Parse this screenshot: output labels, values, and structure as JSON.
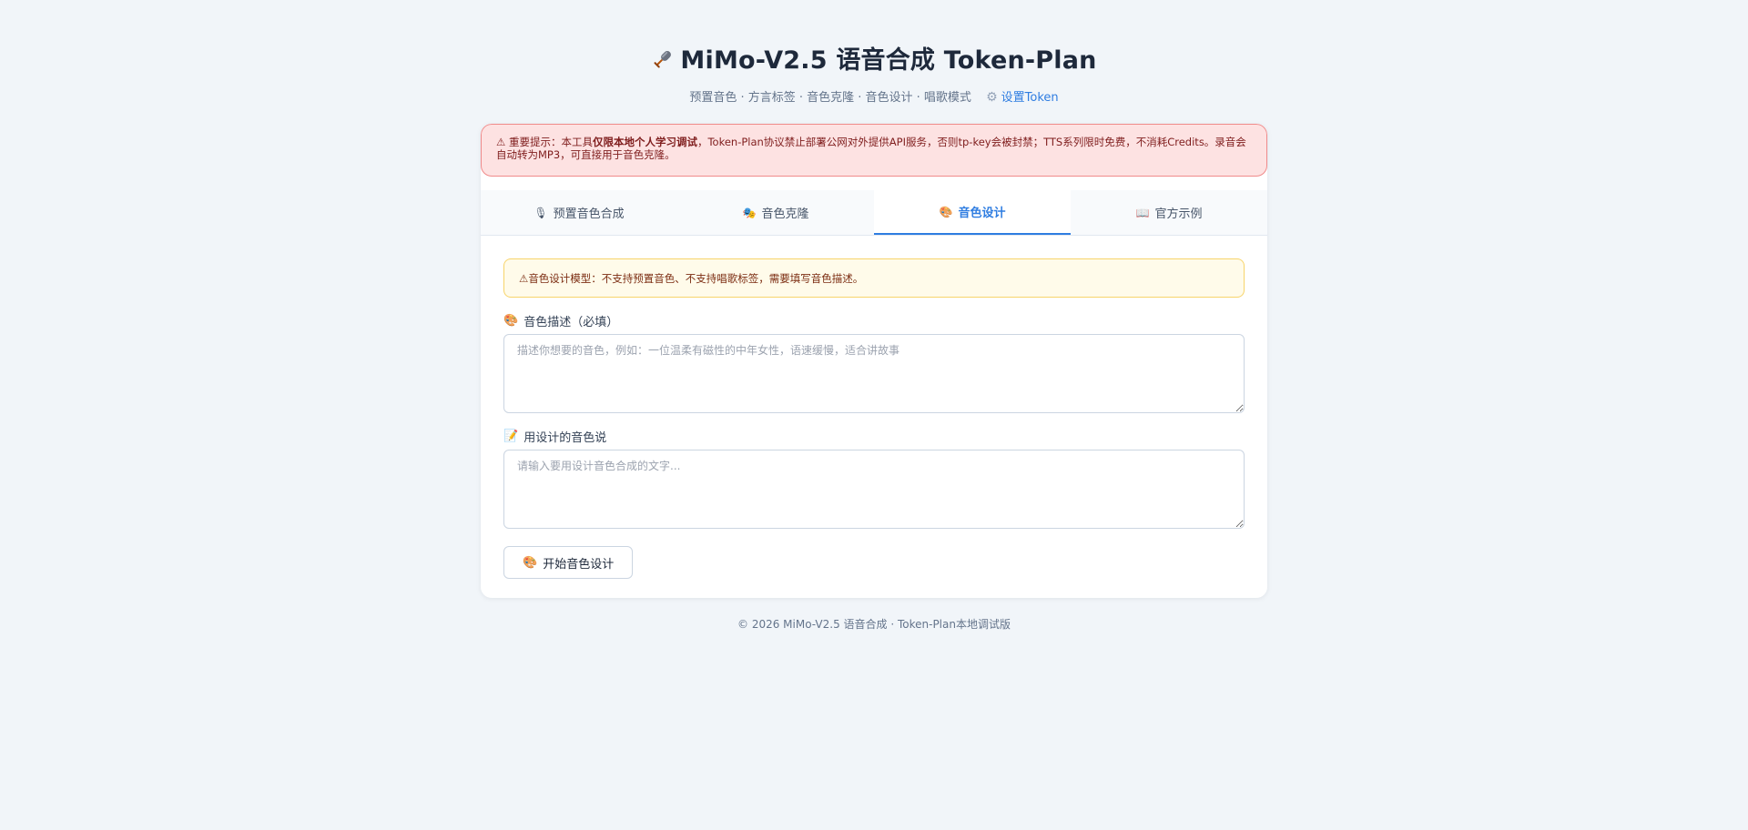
{
  "header": {
    "icon": "microphone-icon",
    "title": "MiMo-V2.5 语音合成 Token-Plan",
    "subtitle": "预置音色 · 方言标签 · 音色克隆 · 音色设计 · 唱歌模式",
    "settings_icon": "gear-icon",
    "settings_link": "设置Token"
  },
  "alert": {
    "icon": "warning-icon",
    "prefix": "重要提示：本工具",
    "emphasis": "仅限本地个人学习调试",
    "rest": "，Token-Plan协议禁止部署公网对外提供API服务，否则tp-key会被封禁；TTS系列限时免费，不消耗Credits。录音会自动转为MP3，可直接用于音色克隆。"
  },
  "tabs": [
    {
      "label": "预置音色合成",
      "icon": "microphone-icon",
      "active": false
    },
    {
      "label": "音色克隆",
      "icon": "masks-icon",
      "active": false
    },
    {
      "label": "音色设计",
      "icon": "palette-icon",
      "active": true
    },
    {
      "label": "官方示例",
      "icon": "book-icon",
      "active": false
    }
  ],
  "notice": {
    "icon": "warning-icon",
    "text": "音色设计模型：不支持预置音色、不支持唱歌标签，需要填写音色描述。"
  },
  "voice_description": {
    "icon": "palette-icon",
    "label": "音色描述（必填）",
    "placeholder": "描述你想要的音色，例如：一位温柔有磁性的中年女性，语速缓慢，适合讲故事",
    "value": ""
  },
  "speech_text": {
    "icon": "memo-icon",
    "label": "用设计的音色说",
    "placeholder": "请输入要用设计音色合成的文字...",
    "value": ""
  },
  "start_button": {
    "icon": "palette-icon",
    "label": "开始音色设计"
  },
  "footer": {
    "text": "© 2026 MiMo-V2.5 语音合成 · Token-Plan本地调试版"
  },
  "colors": {
    "accent": "#2f7de1",
    "alert_bg": "#fde2e2",
    "notice_bg": "#fffbea",
    "page_bg": "#f1f5f9"
  }
}
